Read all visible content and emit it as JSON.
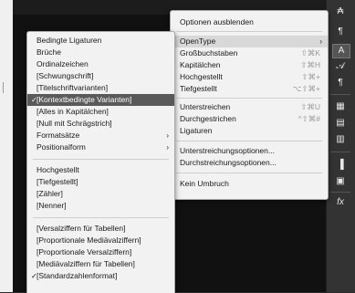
{
  "main_menu": {
    "hide_options": "Optionen ausblenden",
    "items": [
      {
        "label": "OpenType",
        "shortcut": "",
        "submenu": true
      },
      {
        "label": "Großbuchstaben",
        "shortcut": "⇧⌘K"
      },
      {
        "label": "Kapitälchen",
        "shortcut": "⇧⌘H"
      },
      {
        "label": "Hochgestellt",
        "shortcut": "⇧⌘+"
      },
      {
        "label": "Tiefgestellt",
        "shortcut": "⌥⇧⌘+"
      },
      {
        "label": "Unterstreichen",
        "shortcut": "⇧⌘U"
      },
      {
        "label": "Durchgestrichen",
        "shortcut": "^⇧⌘#"
      },
      {
        "label": "Ligaturen",
        "shortcut": ""
      },
      {
        "label": "Unterstreichungsoptionen...",
        "shortcut": ""
      },
      {
        "label": "Durchstreichungsoptionen...",
        "shortcut": ""
      },
      {
        "label": "Kein Umbruch",
        "shortcut": ""
      }
    ]
  },
  "opentype_menu": {
    "items": [
      {
        "label": "Bedingte Ligaturen"
      },
      {
        "label": "Brüche"
      },
      {
        "label": "Ordinalzeichen"
      },
      {
        "label": "[Schwungschrift]"
      },
      {
        "label": "[Titelschriftvarianten]"
      },
      {
        "label": "[Kontextbedingte Varianten]",
        "checked": true,
        "highlighted": true
      },
      {
        "label": "[Alles in Kapitälchen]"
      },
      {
        "label": "[Null mit Schrägstrich]"
      },
      {
        "label": "Formatsätze",
        "submenu": true
      },
      {
        "label": "Positionalform",
        "submenu": true
      },
      {
        "label": "Hochgestellt"
      },
      {
        "label": "[Tiefgestellt]"
      },
      {
        "label": "[Zähler]"
      },
      {
        "label": "[Nenner]"
      },
      {
        "label": "[Versalziffern für Tabellen]"
      },
      {
        "label": "[Proportionale Mediävalziffern]"
      },
      {
        "label": "[Proportionale Versalziffern]"
      },
      {
        "label": "[Mediävalziffern für Tabellen]"
      },
      {
        "label": "[Standardzahlenformat]",
        "checked": true
      }
    ]
  },
  "glyphs": {
    "check": "✓",
    "arrow": "›"
  },
  "right_panel": {
    "icons": [
      "character-styles-icon",
      "paragraph-styles-icon",
      "character-icon",
      "glyphs-icon",
      "paragraph-icon",
      "table-icon",
      "cell-styles-icon",
      "table-styles-icon",
      "align-icon",
      "pathfinder-icon",
      "effects-icon"
    ],
    "icon_glyphs": [
      "₳",
      "¶",
      "A",
      "𝒜",
      "¶",
      "▦",
      "▤",
      "▥",
      "▐",
      "▣",
      "fx"
    ]
  }
}
